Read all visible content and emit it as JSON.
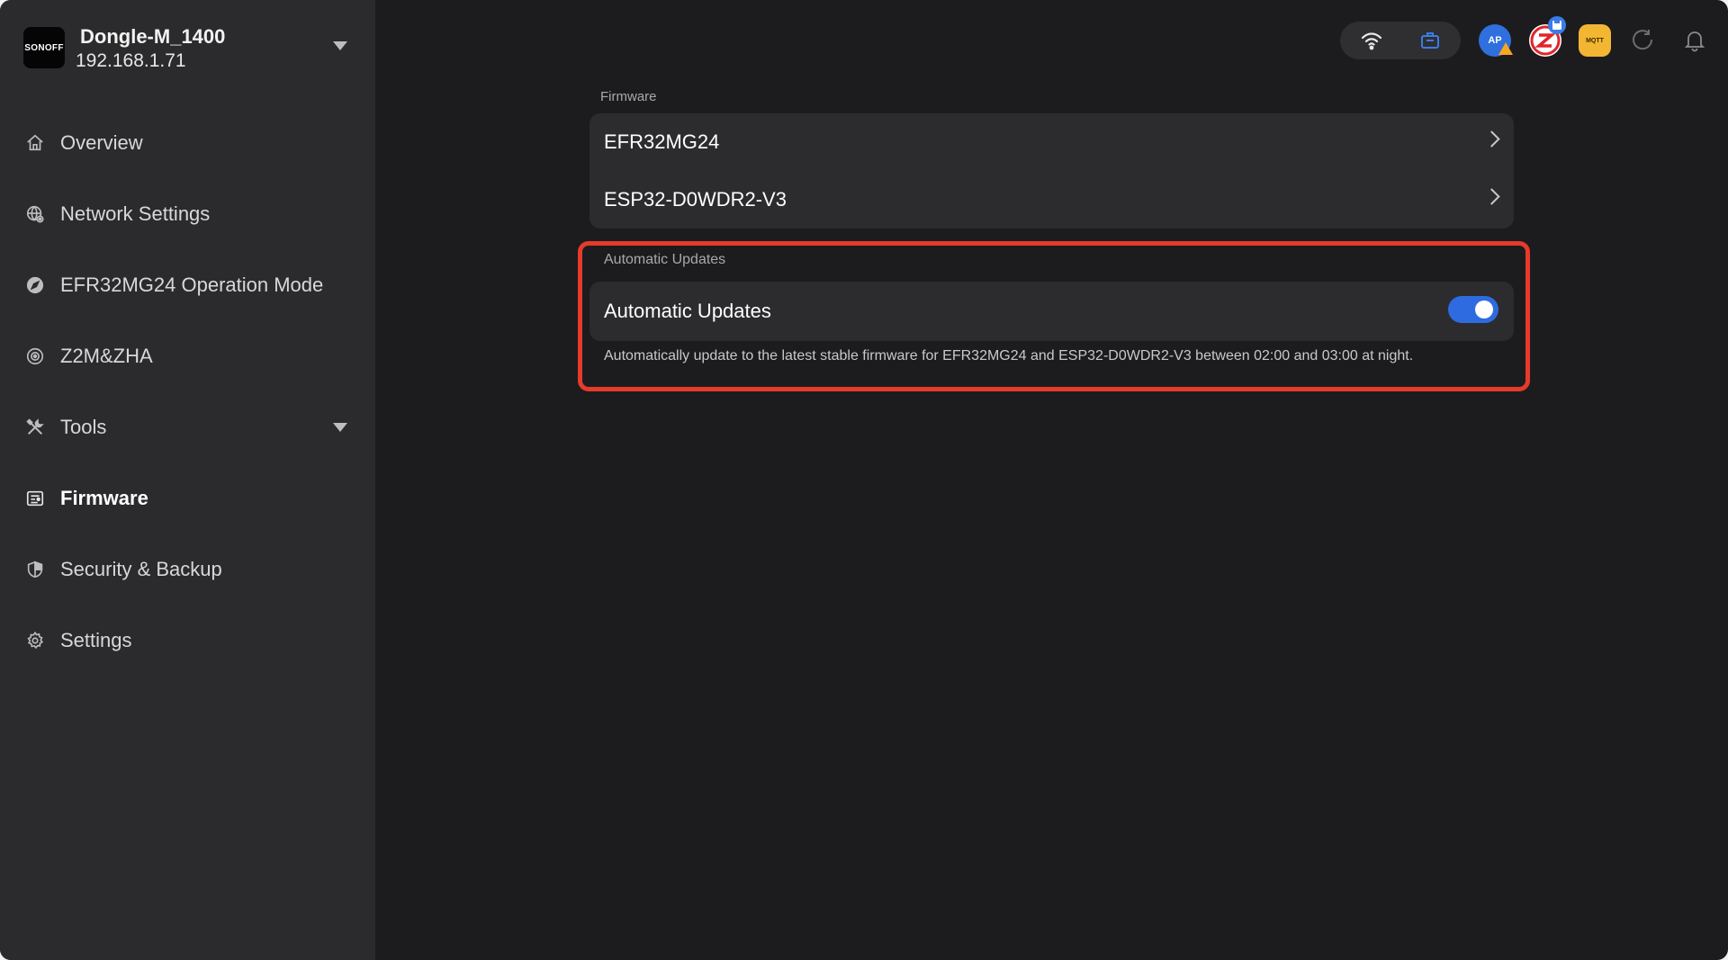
{
  "device": {
    "logo_text": "SONOFF",
    "name": "Dongle-M_1400",
    "ip": "192.168.1.71"
  },
  "sidebar": {
    "items": [
      {
        "label": "Overview",
        "icon": "home-icon"
      },
      {
        "label": "Network Settings",
        "icon": "network-globe-icon"
      },
      {
        "label": "EFR32MG24 Operation Mode",
        "icon": "compass-icon"
      },
      {
        "label": "Z2M&ZHA",
        "icon": "target-icon"
      },
      {
        "label": "Tools",
        "icon": "tools-icon"
      },
      {
        "label": "Firmware",
        "icon": "firmware-icon"
      },
      {
        "label": "Security & Backup",
        "icon": "shield-icon"
      },
      {
        "label": "Settings",
        "icon": "gear-icon"
      }
    ],
    "active": "Firmware"
  },
  "status_bar": {
    "ap_text": "AP",
    "mqtt_text": "MQTT"
  },
  "firmware": {
    "section_label": "Firmware",
    "rows": [
      {
        "label": "EFR32MG24"
      },
      {
        "label": "ESP32-D0WDR2-V3"
      }
    ]
  },
  "auto_updates": {
    "section_label": "Automatic Updates",
    "label": "Automatic Updates",
    "enabled": true,
    "description": "Automatically update to the latest stable firmware for EFR32MG24 and ESP32-D0WDR2-V3 between 02:00 and 03:00 at night."
  },
  "colors": {
    "accent": "#2f6be0",
    "highlight": "#e53a2c",
    "sidebar_bg": "#2b2b2d",
    "main_bg": "#1c1c1e",
    "card_bg": "#2c2c2e"
  }
}
